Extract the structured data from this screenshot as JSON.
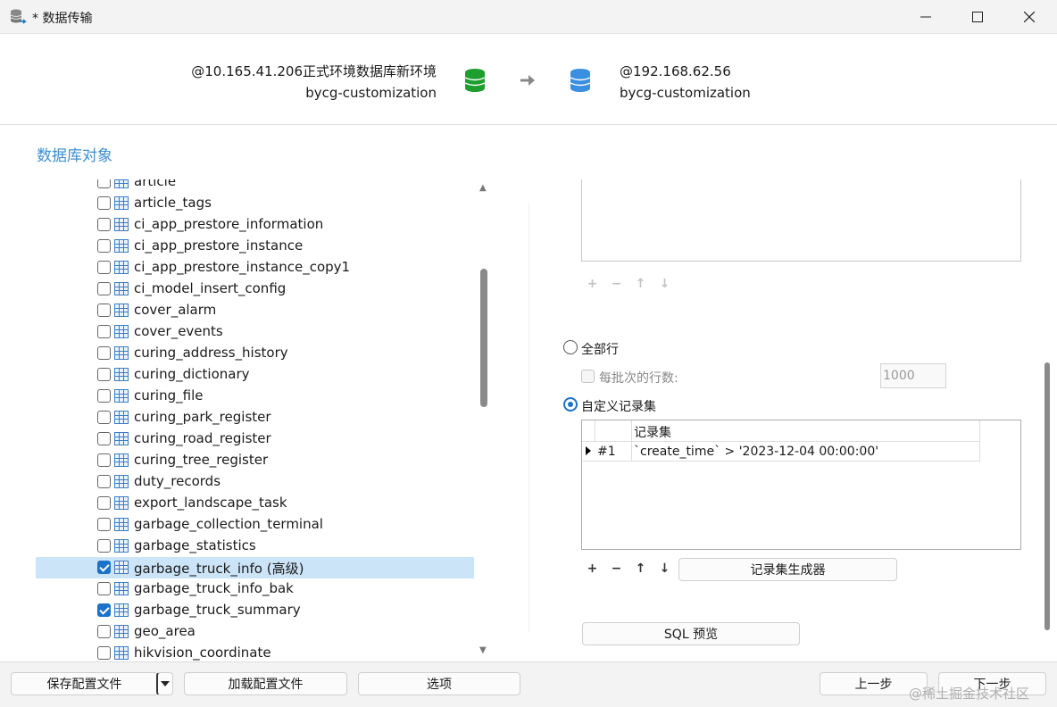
{
  "window": {
    "title": "* 数据传输"
  },
  "source": {
    "server": "@10.165.41.206正式环境数据库新环境",
    "database": "bycg-customization",
    "icon": "database-green-icon",
    "color": "#1e9e2f"
  },
  "target": {
    "server": "@192.168.62.56",
    "database": "bycg-customization",
    "icon": "database-blue-icon",
    "color": "#3b8fe0"
  },
  "section_title": "数据库对象",
  "tables": [
    {
      "name": "article",
      "checked": false
    },
    {
      "name": "article_tags",
      "checked": false
    },
    {
      "name": "ci_app_prestore_information",
      "checked": false
    },
    {
      "name": "ci_app_prestore_instance",
      "checked": false
    },
    {
      "name": "ci_app_prestore_instance_copy1",
      "checked": false
    },
    {
      "name": "ci_model_insert_config",
      "checked": false
    },
    {
      "name": "cover_alarm",
      "checked": false
    },
    {
      "name": "cover_events",
      "checked": false
    },
    {
      "name": "curing_address_history",
      "checked": false
    },
    {
      "name": "curing_dictionary",
      "checked": false
    },
    {
      "name": "curing_file",
      "checked": false
    },
    {
      "name": "curing_park_register",
      "checked": false
    },
    {
      "name": "curing_road_register",
      "checked": false
    },
    {
      "name": "curing_tree_register",
      "checked": false
    },
    {
      "name": "duty_records",
      "checked": false
    },
    {
      "name": "export_landscape_task",
      "checked": false
    },
    {
      "name": "garbage_collection_terminal",
      "checked": false
    },
    {
      "name": "garbage_statistics",
      "checked": false
    },
    {
      "name": "garbage_truck_info (高级)",
      "checked": true,
      "selected": true
    },
    {
      "name": "garbage_truck_info_bak",
      "checked": false
    },
    {
      "name": "garbage_truck_summary",
      "checked": true
    },
    {
      "name": "geo_area",
      "checked": false
    },
    {
      "name": "hikvision_coordinate",
      "checked": false
    }
  ],
  "options": {
    "all_rows_label": "全部行",
    "batch_label": "每批次的行数:",
    "batch_value": "1000",
    "custom_label": "自定义记录集"
  },
  "recordset": {
    "header": "记录集",
    "rows": [
      {
        "id": "#1",
        "value": "`create_time` > '2023-12-04 00:00:00'"
      }
    ]
  },
  "buttons": {
    "generator": "记录集生成器",
    "sql_preview": "SQL 预览",
    "save_profile": "保存配置文件",
    "load_profile": "加载配置文件",
    "options": "选项",
    "prev": "上一步",
    "next": "下一步"
  },
  "watermark": "@稀土掘金技术社区"
}
